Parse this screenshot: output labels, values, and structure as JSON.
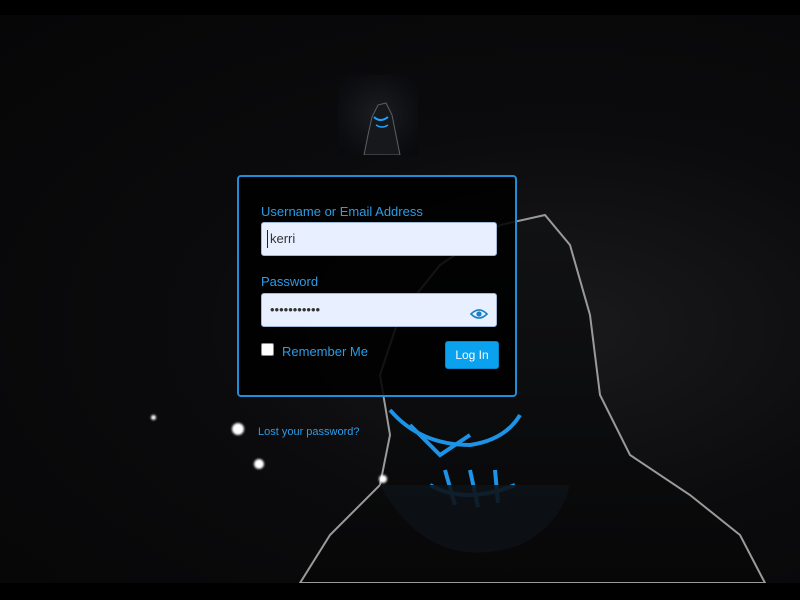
{
  "login": {
    "username_label": "Username or Email Address",
    "username_value": "kerri",
    "password_label": "Password",
    "password_masked": "•••••••••••",
    "remember_label": "Remember Me",
    "login_button_label": "Log In"
  },
  "links": {
    "lost_password": "Lost your password?"
  },
  "icons": {
    "show_password": "eye-icon"
  },
  "colors": {
    "accent": "#1e8ed8",
    "label": "#2b9ce6",
    "button": "#0aa1ee",
    "input_bg": "#e8efff"
  }
}
